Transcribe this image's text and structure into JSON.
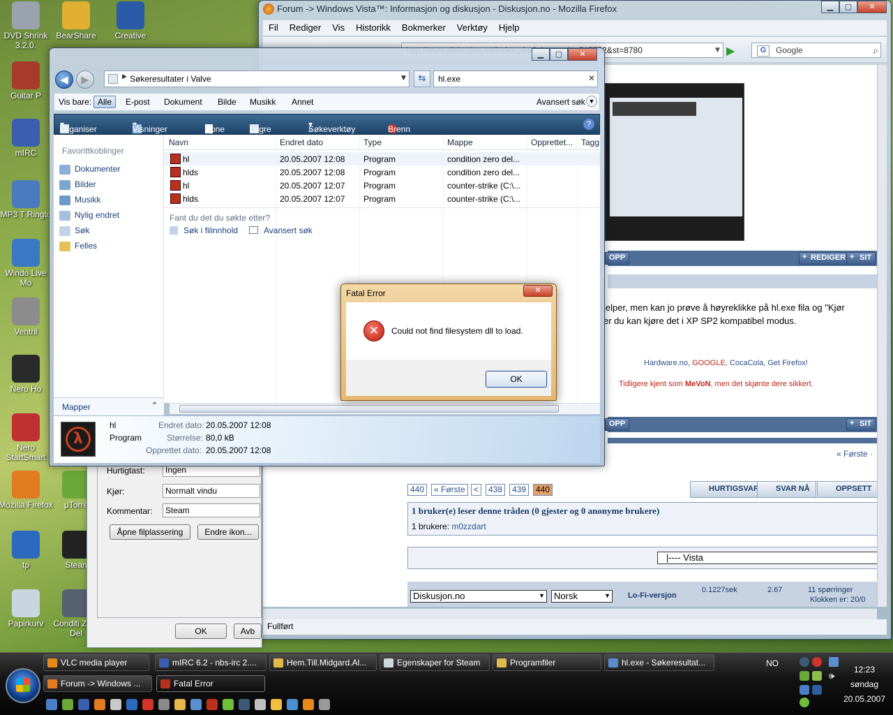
{
  "desktop": {
    "icons": [
      {
        "label": "DVD Shrink 3.2.0.",
        "color": "#9aa2ad"
      },
      {
        "label": "BearShare",
        "color": "#e1b030"
      },
      {
        "label": "Creative",
        "color": "#2a5aa8"
      },
      {
        "label": "Guitar P",
        "color": "#a83a2a"
      },
      {
        "label": "mIRC",
        "color": "#3b5fb0"
      },
      {
        "label": "MP3 T Ringto",
        "color": "#4a7ac0"
      },
      {
        "label": "Windo Live Mo",
        "color": "#3a78c4"
      },
      {
        "label": "Ventril",
        "color": "#8c8c8c"
      },
      {
        "label": "Nero Ho",
        "color": "#2a2a2a"
      },
      {
        "label": "Nero StartSmart",
        "color": "#c03030"
      },
      {
        "label": "Mozilla Firefox",
        "color": "#e27a20"
      },
      {
        "label": "µTorre",
        "color": "#6aa83a"
      },
      {
        "label": "tp",
        "color": "#2c6ac0"
      },
      {
        "label": "Stean",
        "color": "#222222"
      },
      {
        "label": "Papirkurv",
        "color": "#c9d6df"
      },
      {
        "label": "Conditi Zero Del",
        "color": "#556070"
      }
    ]
  },
  "firefox": {
    "title": "Forum -> Windows Vista™: Informasjon og diskusjon - Diskusjon.no - Mozilla Firefox",
    "menu": [
      "Fil",
      "Rediger",
      "Vis",
      "Historikk",
      "Bokmerker",
      "Verktøy",
      "Hjelp"
    ],
    "url": "http://www.diskusjon.no/index.php?showtopic=517752&st=8780",
    "search_placeholder": "Google",
    "status": "Fullført",
    "forum": {
      "edit_label": "REDIGER",
      "site_label": "SIT",
      "opp_label": "OPP",
      "post_line1": "jelper, men kan jo prøve å høyreklikke på hl.exe fila og \"Kjør",
      "post_line2": "er du kan kjøre det i XP SP2 kompatibel modus.",
      "sig_links": [
        "Hardware.no",
        "GOOGLE",
        "CocaCola",
        "Get Firefox!"
      ],
      "sig_line2_a": "Tidligere kjent som ",
      "sig_line2_name": "MeVoN",
      "sig_line2_b": ", men det skjønte dere sikkert.",
      "forste_right": "« Første ·",
      "pages": [
        "440",
        "« Første",
        "<",
        "438",
        "439",
        "440"
      ],
      "buttons": [
        "HURTIGSVAR",
        "SVAR NÅ",
        "OPPSETT"
      ],
      "readers_title": "1 bruker(e) leser denne tråden (0 gjester og 0 anonyme brukere)",
      "readers_prefix": "1 brukere: ",
      "readers_user": "m0zzdart",
      "jump_select": "|---- Vista",
      "footer_site": "Diskusjon.no",
      "footer_lang": "Norsk",
      "footer_lofi": "Lo-Fi-versjon",
      "footer_time": "0.1227sek",
      "footer_load": "2.67",
      "footer_queries": "11 spørringer",
      "footer_clock": "Klokken er: 20/0"
    }
  },
  "properties": {
    "hotkey_label": "Hurtigtast:",
    "hotkey_value": "Ingen",
    "run_label": "Kjør:",
    "run_value": "Normalt vindu",
    "comment_label": "Kommentar:",
    "comment_value": "Steam",
    "open_location": "Åpne filplassering",
    "change_icon": "Endre ikon...",
    "ok": "OK",
    "cancel": "Avb"
  },
  "explorer": {
    "address": "Søkeresultater i Valve",
    "search_value": "hl.exe",
    "filter_label": "Vis bare:",
    "filters": [
      "Alle",
      "E-post",
      "Dokument",
      "Bilde",
      "Musikk",
      "Annet"
    ],
    "advanced_search": "Avansert søk",
    "toolbar": [
      "Organiser",
      "Visninger",
      "Åpne",
      "Lagre søk",
      "Søkeverktøy",
      "Brenn"
    ],
    "nav_header": "Favorittkoblinger",
    "nav_items": [
      "Dokumenter",
      "Bilder",
      "Musikk",
      "Nylig endret",
      "Søk",
      "Felles"
    ],
    "folders_label": "Mapper",
    "columns": [
      "Navn",
      "Endret dato",
      "Type",
      "Mappe",
      "Opprettet...",
      "Tagg"
    ],
    "rows": [
      {
        "name": "hl",
        "date": "20.05.2007 12:08",
        "type": "Program",
        "folder": "condition zero del..."
      },
      {
        "name": "hlds",
        "date": "20.05.2007 12:08",
        "type": "Program",
        "folder": "condition zero del..."
      },
      {
        "name": "hl",
        "date": "20.05.2007 12:07",
        "type": "Program",
        "folder": "counter-strike (C:\\..."
      },
      {
        "name": "hlds",
        "date": "20.05.2007 12:07",
        "type": "Program",
        "folder": "counter-strike (C:\\..."
      }
    ],
    "not_found_prompt": "Fant du det du søkte etter?",
    "search_in_content": "Søk i filinnhold",
    "advanced_search_link": "Avansert søk",
    "details": {
      "name": "hl",
      "type": "Program",
      "modified_label": "Endret dato:",
      "modified": "20.05.2007 12:08",
      "size_label": "Størrelse:",
      "size": "80,0 kB",
      "created_label": "Opprettet dato:",
      "created": "20.05.2007 12:08"
    }
  },
  "error_dialog": {
    "title": "Fatal Error",
    "message": "Could not find filesystem dll to load.",
    "ok": "OK"
  },
  "taskbar": {
    "row1": [
      {
        "label": "VLC media player",
        "color": "#e8891c"
      },
      {
        "label": "mIRC 6.2 - nbs-irc 2....",
        "color": "#3b5fb0"
      },
      {
        "label": "Hem.Till.Midgard.Al...",
        "color": "#e2b94a"
      },
      {
        "label": "Egenskaper for Steam",
        "color": "#cfd6de"
      },
      {
        "label": "Programfiler",
        "color": "#e2b94a"
      },
      {
        "label": "hl.exe - Søkeresultat...",
        "color": "#5b8ed0"
      }
    ],
    "row2": [
      {
        "label": "Forum -> Windows ...",
        "color": "#e27a20"
      },
      {
        "label": "Fatal Error",
        "color": "#b8311c"
      }
    ],
    "language": "NO",
    "time": "12:23",
    "day": "søndag",
    "date": "20.05.2007",
    "quick_launch_count": 18
  }
}
